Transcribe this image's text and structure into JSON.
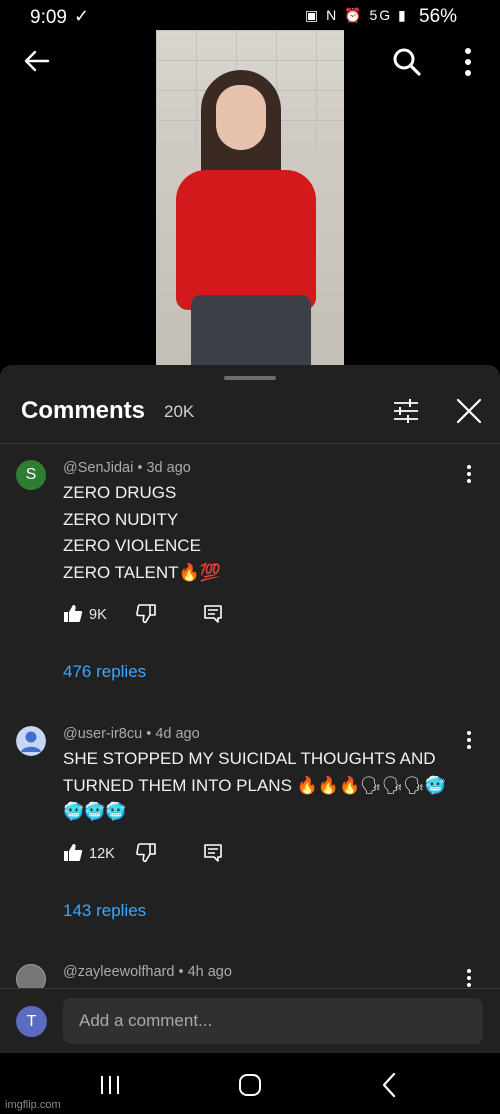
{
  "status_bar": {
    "time": "9:09",
    "check_glyph": "✓",
    "icons_text": "▣ N ⏰ 5G ▮",
    "battery": "56%"
  },
  "header": {
    "back_icon": "arrow-left-icon",
    "search_icon": "search-icon",
    "more_icon": "more-vert-icon"
  },
  "comments_panel": {
    "title": "Comments",
    "count": "20K",
    "filter_icon": "sliders-icon",
    "close_icon": "close-icon",
    "comments": [
      {
        "avatar_letter": "S",
        "avatar_color": "#2e7d32",
        "meta": "@SenJidai • 3d ago",
        "text": "ZERO DRUGS\nZERO NUDITY\nZERO VIOLENCE\nZERO TALENT🔥💯",
        "likes": "9K",
        "replies": "476 replies"
      },
      {
        "avatar_letter": "",
        "avatar_color": "#c7d6f2",
        "meta": "@user-ir8cu • 4d ago",
        "text": "SHE STOPPED MY SUICIDAL THOUGHTS AND TURNED THEM INTO PLANS 🔥🔥🔥🗣🗣🗣🥶\n🥶🥶🥶",
        "likes": "12K",
        "replies": "143 replies"
      },
      {
        "avatar_letter": "",
        "avatar_color": "#777777",
        "meta": "@zayleewolfhard • 4h ago"
      }
    ]
  },
  "add_comment": {
    "avatar_letter": "T",
    "placeholder": "Add a comment..."
  },
  "nav": {
    "recent_icon": "recent-apps-icon",
    "home_icon": "home-icon",
    "back_icon": "back-chevron-icon"
  },
  "watermark": "imgflip.com"
}
